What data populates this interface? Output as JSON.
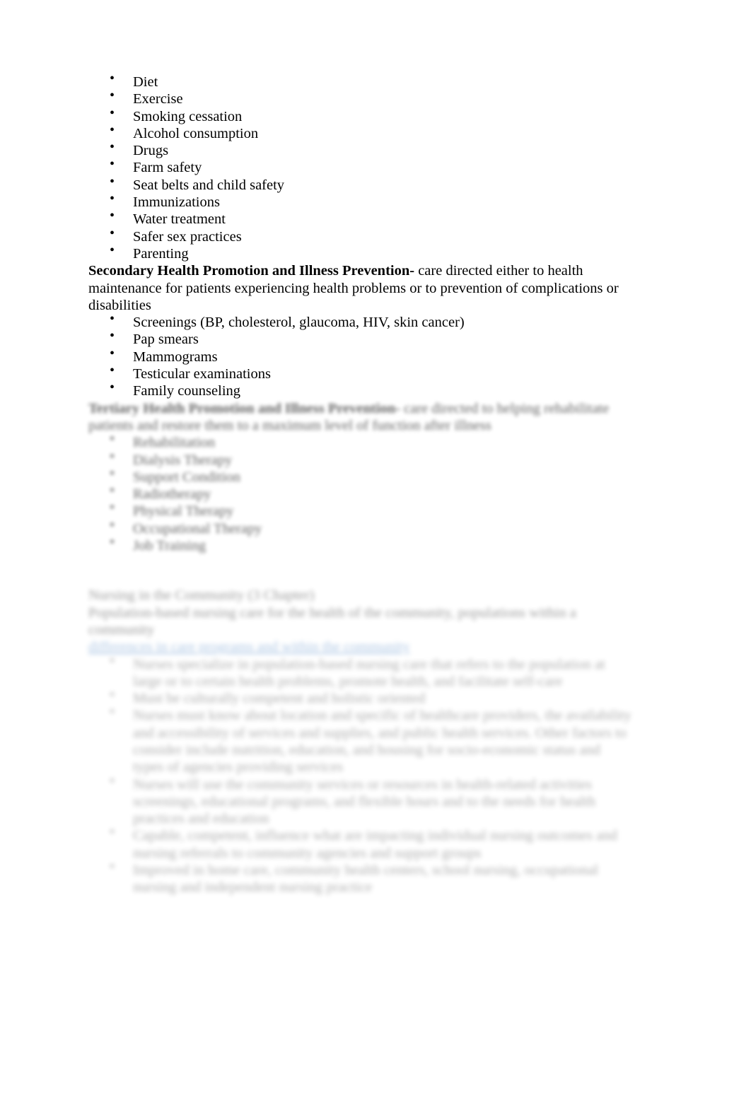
{
  "document": {
    "primary_list": [
      "Diet",
      "Exercise",
      "Smoking cessation",
      "Alcohol consumption",
      "Drugs",
      "Farm safety",
      "Seat belts and child safety",
      "Immunizations",
      "Water treatment",
      "Safer sex practices",
      "Parenting"
    ],
    "secondary_section": {
      "lead": "Secondary Health Promotion and Illness Prevention-",
      "body": " care directed either to health maintenance for patients experiencing health problems or to prevention of complications or disabilities",
      "items": [
        "Screenings (BP, cholesterol, glaucoma, HIV, skin cancer)",
        "Pap smears",
        "Mammograms",
        "Testicular examinations",
        "Family counseling"
      ]
    },
    "tertiary_section": {
      "lead": "Tertiary Health Promotion and Illness Prevention-",
      "body": " care directed to helping rehabilitate patients and restore them to a maximum level of function after illness",
      "items": [
        "Rehabilitation",
        "Dialysis Therapy",
        "Support Condition",
        "Radiotherapy",
        "Physical Therapy",
        "Occupational Therapy",
        "Job Training"
      ]
    },
    "community_section": {
      "heading": "Nursing in the Community (3 Chapter)",
      "intro": "Population-based nursing care for the health of the community, populations within a community",
      "link_text": "differences in care programs and within the community",
      "items": [
        "Nurses specialize in population-based nursing care that refers to the population at large or to certain health problems, promote health, and facilitate self-care",
        "Must be culturally competent and holistic oriented",
        "Nurses must know about location and specific of healthcare providers, the availability and accessibility of services and supplies, and public health services. Other factors to consider include nutrition, education, and housing for socio-economic status and types of agencies providing services",
        "Nurses will use the community services or resources in health-related activities screenings, educational programs, and flexible hours and to the needs for health practices and education",
        "Capable, competent, influence what are impacting individual nursing outcomes and nursing referrals to community agencies and support groups",
        "Improved in home care, community health centers, school nursing, occupational nursing and independent nursing practice"
      ]
    }
  }
}
